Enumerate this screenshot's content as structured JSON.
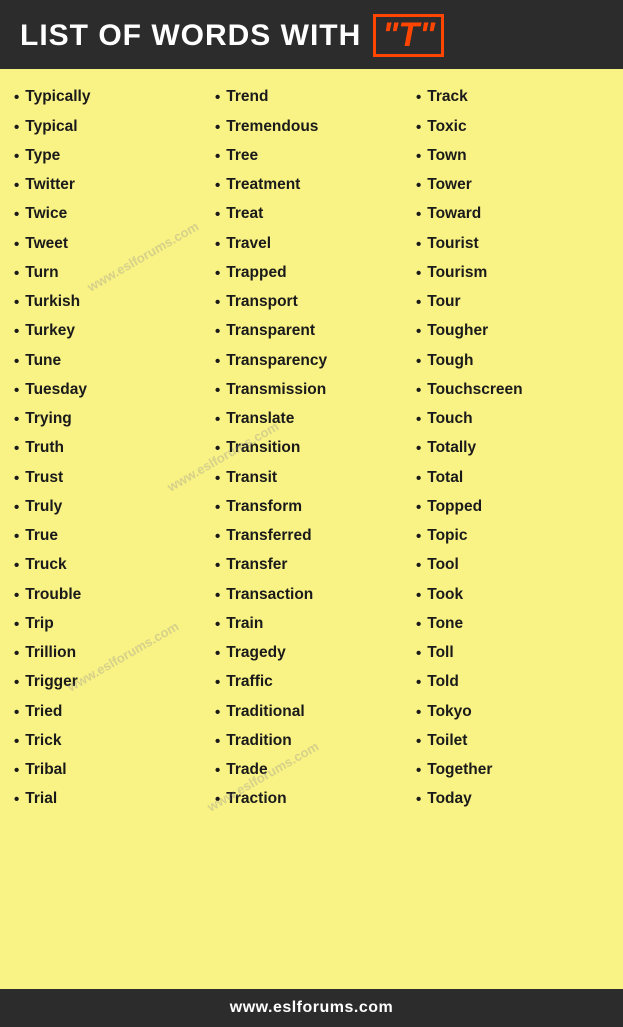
{
  "header": {
    "title": "LIST OF WORDS WITH",
    "letter": "\"T\""
  },
  "columns": [
    {
      "words": [
        "Typically",
        "Typical",
        "Type",
        "Twitter",
        "Twice",
        "Tweet",
        "Turn",
        "Turkish",
        "Turkey",
        "Tune",
        "Tuesday",
        "Trying",
        "Truth",
        "Trust",
        "Truly",
        "True",
        "Truck",
        "Trouble",
        "Trip",
        "Trillion",
        "Trigger",
        "Tried",
        "Trick",
        "Tribal",
        "Trial"
      ]
    },
    {
      "words": [
        "Trend",
        "Tremendous",
        "Tree",
        "Treatment",
        "Treat",
        "Travel",
        "Trapped",
        "Transport",
        "Transparent",
        "Transparency",
        "Transmission",
        "Translate",
        "Transition",
        "Transit",
        "Transform",
        "Transferred",
        "Transfer",
        "Transaction",
        "Train",
        "Tragedy",
        "Traffic",
        "Traditional",
        "Tradition",
        "Trade",
        "Traction"
      ]
    },
    {
      "words": [
        "Track",
        "Toxic",
        "Town",
        "Tower",
        "Toward",
        "Tourist",
        "Tourism",
        "Tour",
        "Tougher",
        "Tough",
        "Touchscreen",
        "Touch",
        "Totally",
        "Total",
        "Topped",
        "Topic",
        "Tool",
        "Took",
        "Tone",
        "Toll",
        "Told",
        "Tokyo",
        "Toilet",
        "Together",
        "Today"
      ]
    }
  ],
  "watermarks": [
    "www.eslforums.com",
    "www.eslforums.com",
    "www.eslforums.com",
    "www.eslforums.com"
  ],
  "footer": {
    "url": "www.eslforums.com"
  }
}
